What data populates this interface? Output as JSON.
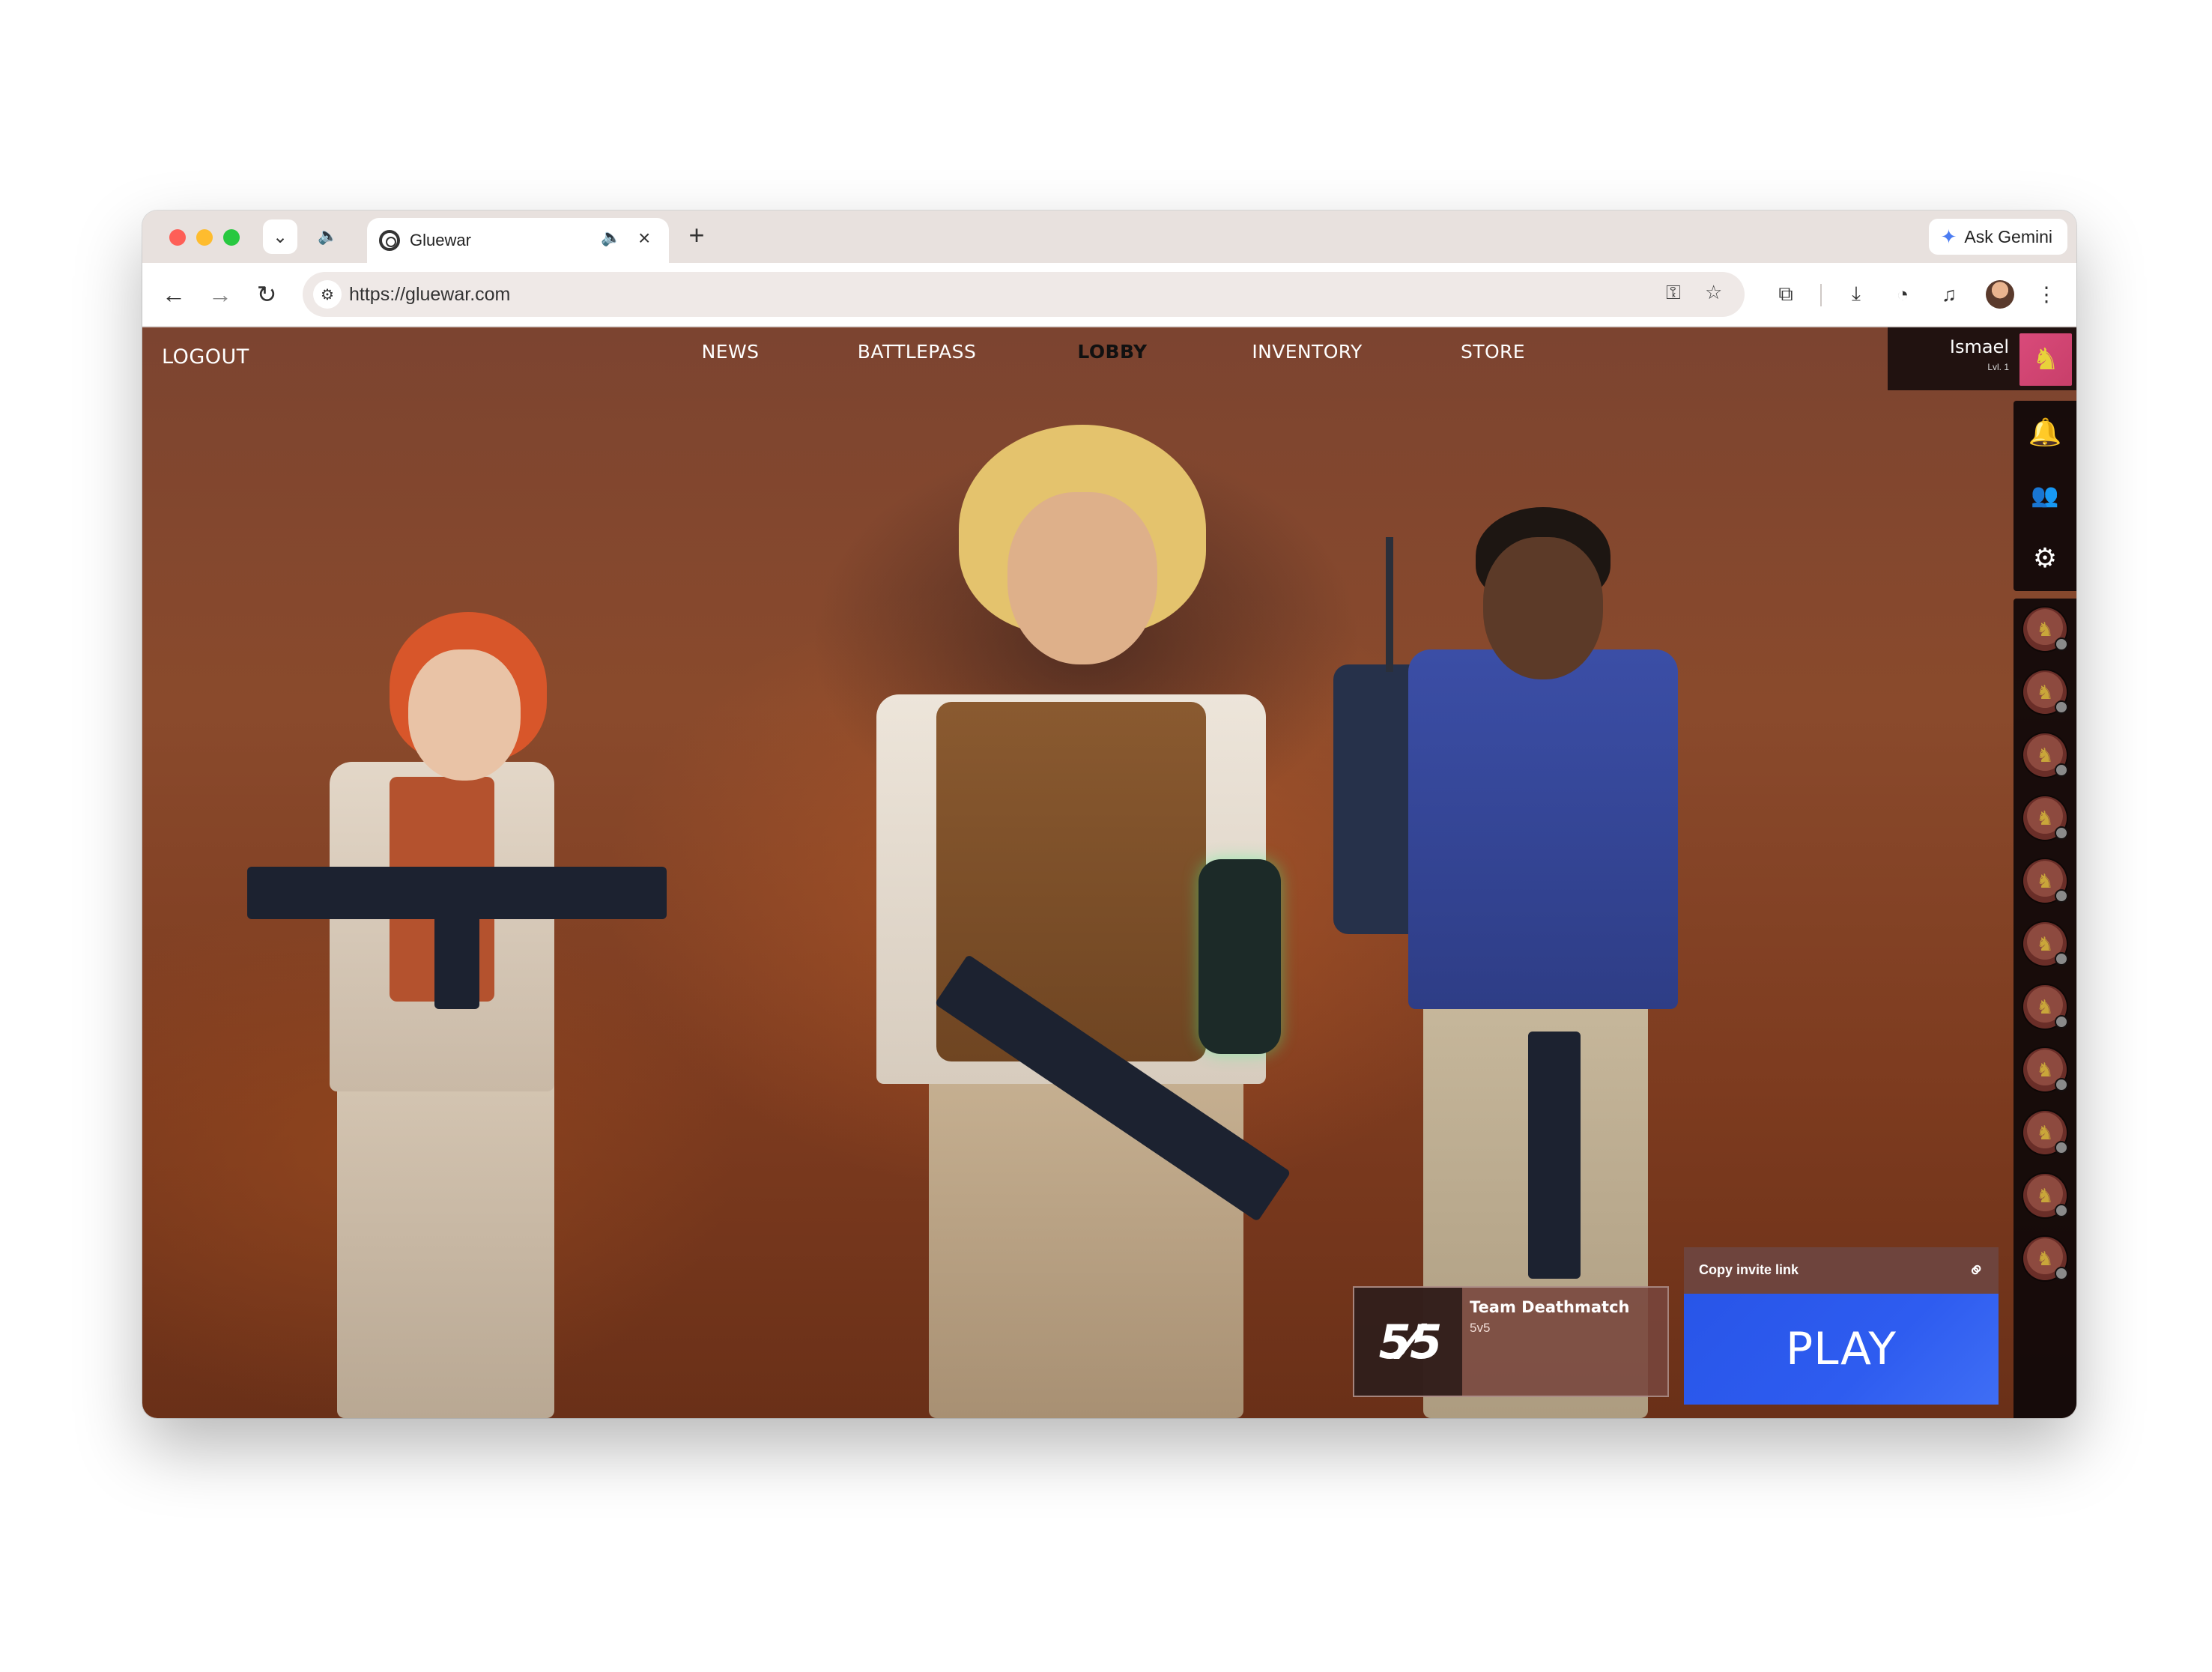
{
  "browser": {
    "tab_title": "Gluewar",
    "url": "https://gluewar.com",
    "ask_gemini_label": "Ask Gemini",
    "new_tab_symbol": "+",
    "close_tab_symbol": "×"
  },
  "game": {
    "logout_label": "LOGOUT",
    "nav": [
      {
        "label": "NEWS",
        "active": false
      },
      {
        "label": "BATTLEPASS",
        "active": false
      },
      {
        "label": "LOBBY",
        "active": true
      },
      {
        "label": "INVENTORY",
        "active": false
      },
      {
        "label": "STORE",
        "active": false
      }
    ],
    "profile": {
      "name": "Ismael",
      "level": "Lvl. 1"
    },
    "side_icons": [
      "bell-icon",
      "friends-icon",
      "gear-icon"
    ],
    "friends_count": 11,
    "mode": {
      "icon_text": "5⁄5",
      "name": "Team Deathmatch",
      "subtitle": "5v5"
    },
    "invite_label": "Copy invite link",
    "play_label": "PLAY"
  },
  "colors": {
    "play_button": "#2855e8",
    "nav_active": "#ffffff",
    "panel_dark": "#120a0a"
  }
}
